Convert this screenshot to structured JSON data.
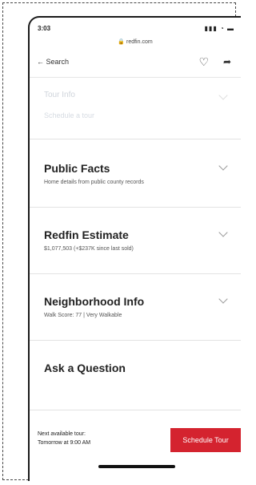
{
  "status": {
    "time": "3:03",
    "icons": "signal wifi battery"
  },
  "url": "redfin.com",
  "nav": {
    "back_label": "Search"
  },
  "sections": [
    {
      "title": "Tour Info",
      "subtitle": "Schedule a tour"
    },
    {
      "title": "Public Facts",
      "subtitle": "Home details from public county records"
    },
    {
      "title": "Redfin Estimate",
      "subtitle": "$1,077,503 (+$237K since last sold)"
    },
    {
      "title": "Neighborhood Info",
      "subtitle": "Walk Score: 77 | Very Walkable"
    },
    {
      "title": "Ask a Question",
      "subtitle": ""
    }
  ],
  "tour": {
    "line1": "Next available tour:",
    "line2": "Tomorrow at 9:00 AM",
    "button": "Schedule Tour"
  },
  "colors": {
    "accent": "#d4232f"
  }
}
